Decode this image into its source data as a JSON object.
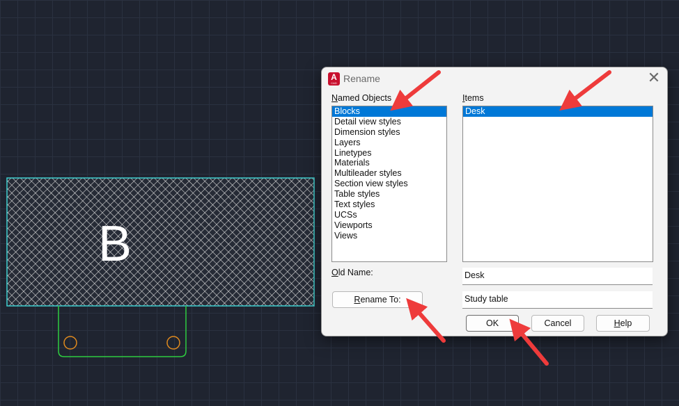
{
  "drawing": {
    "block_letter": "B"
  },
  "dialog": {
    "title": "Rename",
    "app_icon_letter": "A",
    "app_icon_sub": "CAD",
    "close_glyph": "✕",
    "named_objects": {
      "label_first": "N",
      "label_rest": "amed Objects",
      "items": [
        {
          "label": "Blocks",
          "selected": true
        },
        {
          "label": "Detail view styles",
          "selected": false
        },
        {
          "label": "Dimension styles",
          "selected": false
        },
        {
          "label": "Layers",
          "selected": false
        },
        {
          "label": "Linetypes",
          "selected": false
        },
        {
          "label": "Materials",
          "selected": false
        },
        {
          "label": "Multileader styles",
          "selected": false
        },
        {
          "label": "Section view styles",
          "selected": false
        },
        {
          "label": "Table styles",
          "selected": false
        },
        {
          "label": "Text styles",
          "selected": false
        },
        {
          "label": "UCSs",
          "selected": false
        },
        {
          "label": "Viewports",
          "selected": false
        },
        {
          "label": "Views",
          "selected": false
        }
      ]
    },
    "items_list": {
      "label_first": "I",
      "label_rest": "tems",
      "items": [
        {
          "label": "Desk",
          "selected": true
        }
      ]
    },
    "old_name": {
      "label_first": "O",
      "label_rest": "ld Name:",
      "value": "Desk"
    },
    "rename_to": {
      "button_first": "R",
      "button_rest": "ename To:",
      "value": "Study table"
    },
    "buttons": {
      "ok": "OK",
      "cancel": "Cancel",
      "help_first": "H",
      "help_rest": "elp"
    }
  },
  "colors": {
    "selection": "#0078d7",
    "hatch_outline": "#3fd0d0",
    "tab_outline": "#2ecc40",
    "circle": "#e08a1e",
    "arrow": "#ee3b3b"
  }
}
